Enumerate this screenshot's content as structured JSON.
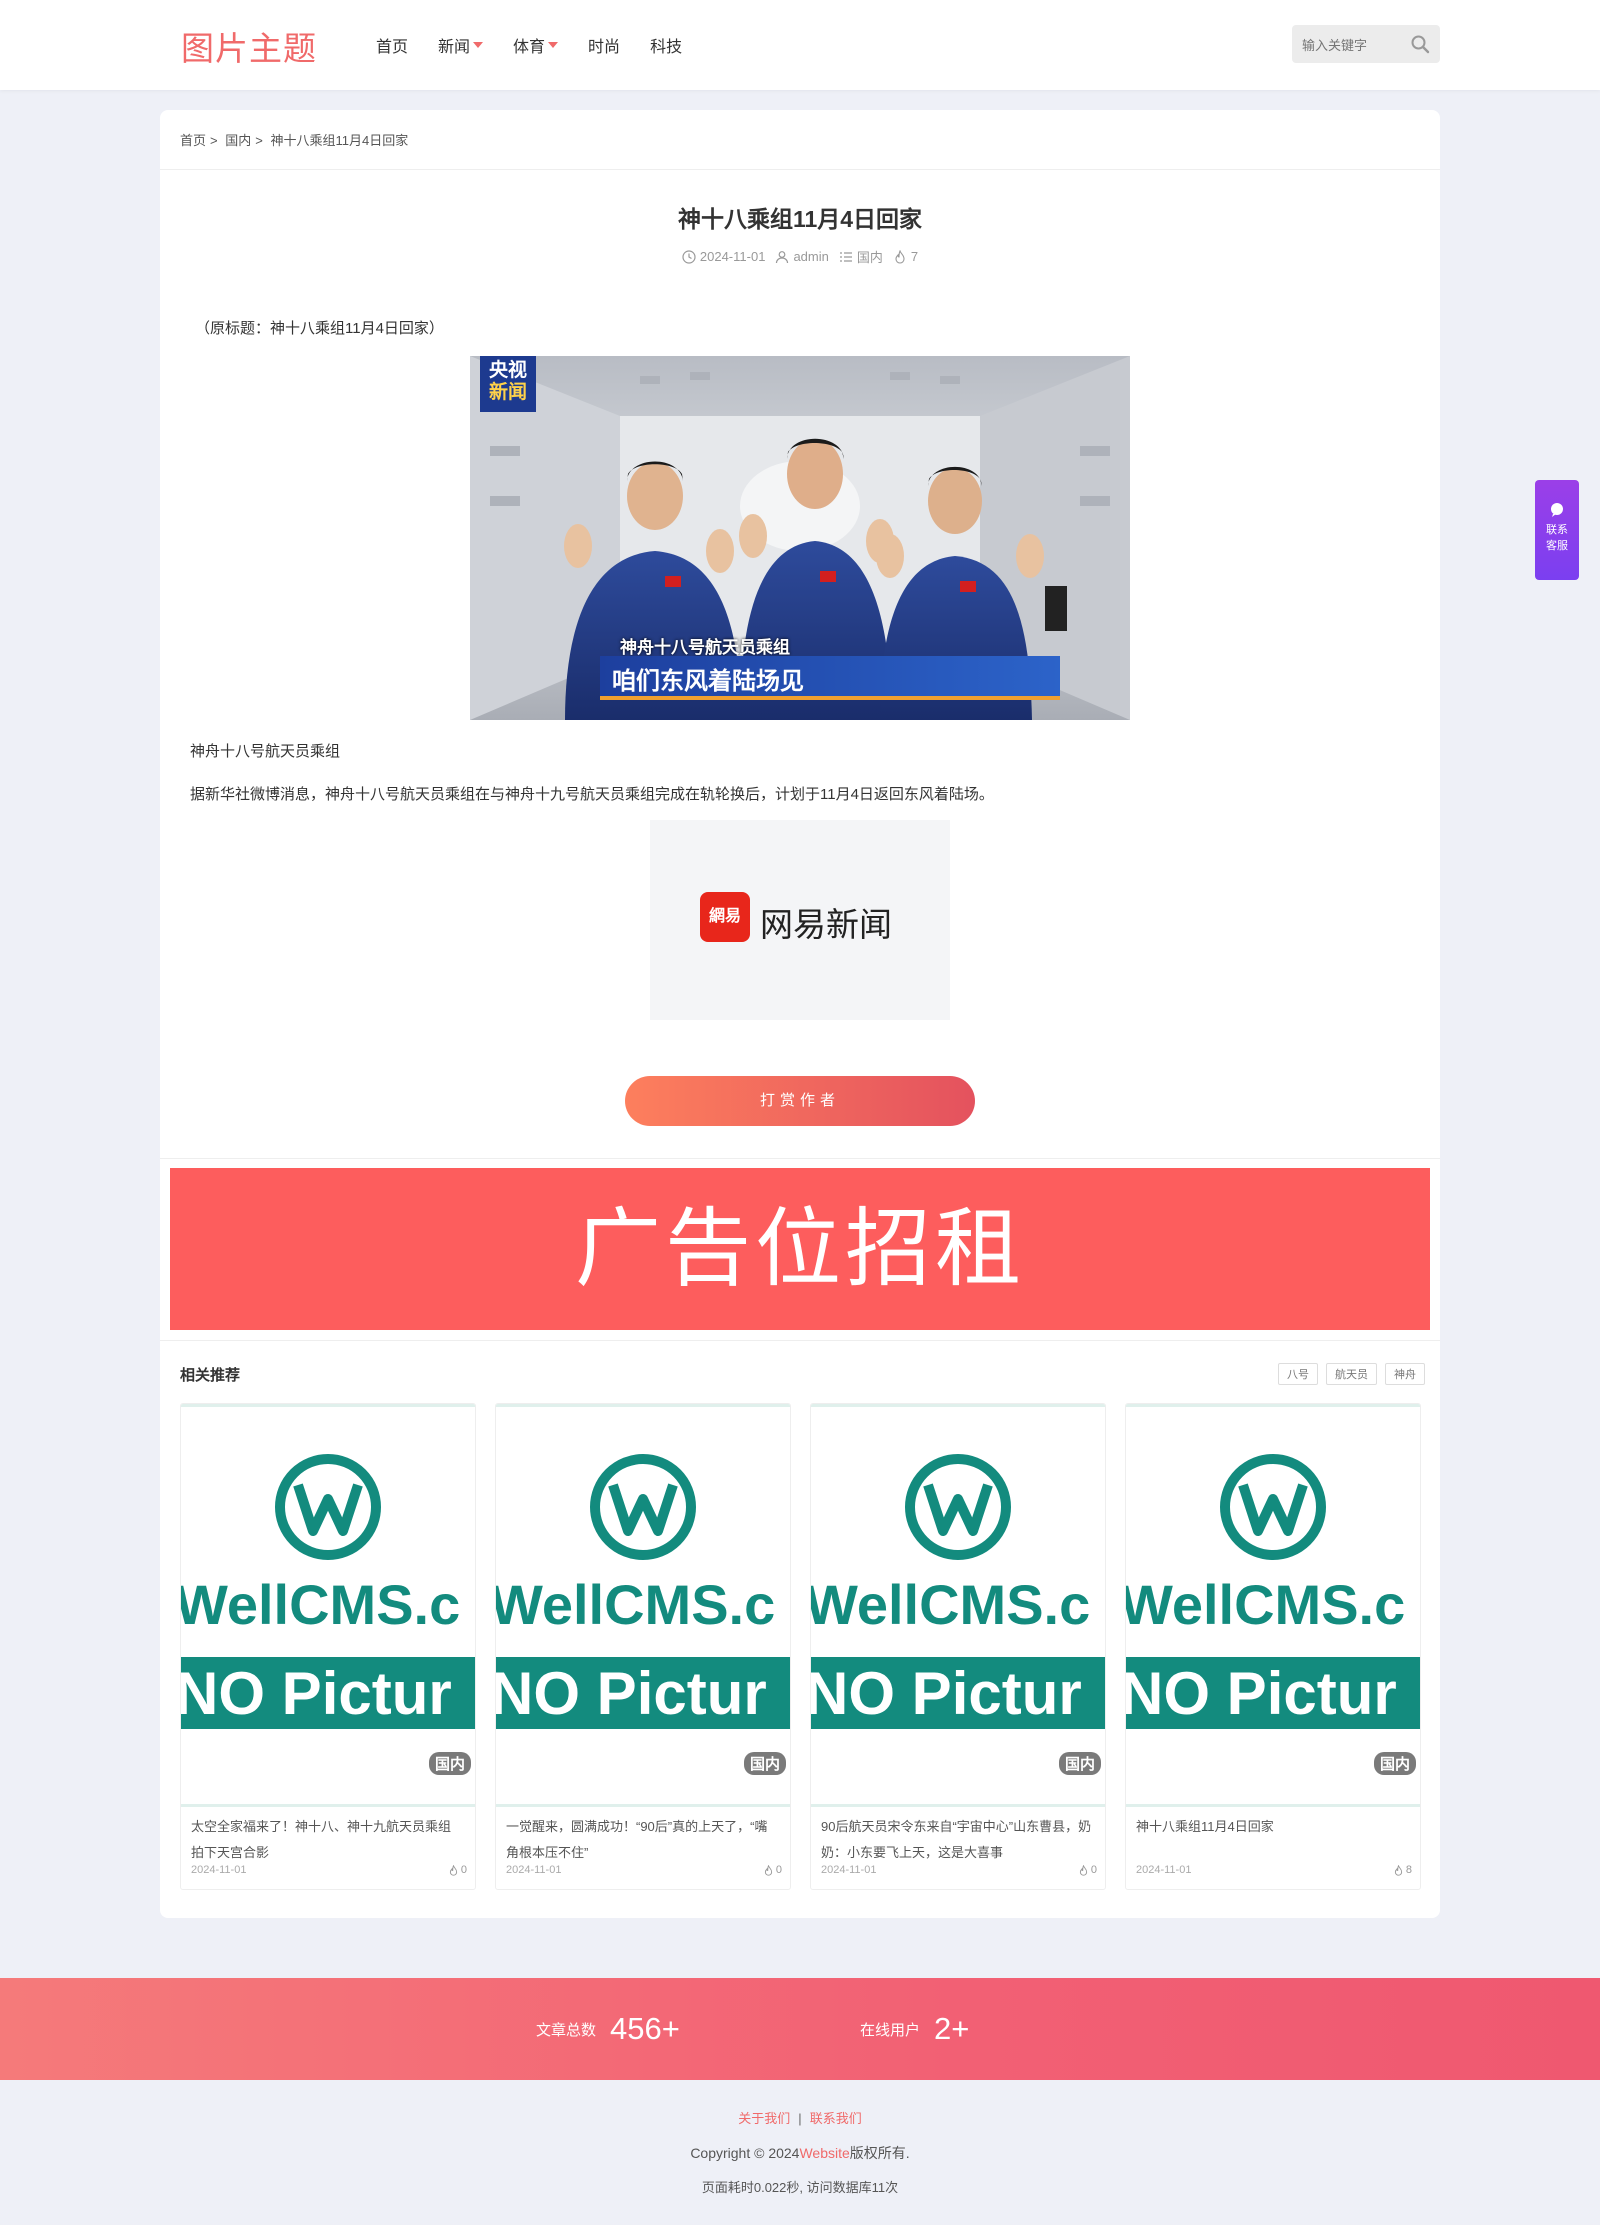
{
  "header": {
    "logo": "图片主题",
    "nav": [
      {
        "label": "首页",
        "dropdown": false
      },
      {
        "label": "新闻",
        "dropdown": true
      },
      {
        "label": "体育",
        "dropdown": true
      },
      {
        "label": "时尚",
        "dropdown": false
      },
      {
        "label": "科技",
        "dropdown": false
      }
    ],
    "search_placeholder": "输入关键字"
  },
  "breadcrumb": [
    "首页",
    "国内",
    "神十八乘组11月4日回家"
  ],
  "article": {
    "title": "神十八乘组11月4日回家",
    "date": "2024-11-01",
    "author": "admin",
    "category": "国内",
    "hits": "7",
    "orig_title": "（原标题：神十八乘组11月4日回家）",
    "photo": {
      "tv_logo_top": "央视",
      "tv_logo_bottom": "新闻",
      "caption_small": "神舟十八号航天员乘组",
      "caption_big": "咱们东风着陆场见"
    },
    "photo_caption": "神舟十八号航天员乘组",
    "body": "据新华社微博消息，神舟十八号航天员乘组在与神舟十九号航天员乘组完成在轨轮换后，计划于11月4日返回东风着陆场。",
    "source_logo_icon": "網易",
    "source_logo_text": "网易新闻",
    "reward_label": "打赏作者"
  },
  "ad": {
    "text": "广告位招租"
  },
  "related": {
    "title": "相关推荐",
    "tags": [
      "八号",
      "航天员",
      "神舟"
    ],
    "placeholder": {
      "line1": "WellCMS.c",
      "line2": "NO Pictur"
    },
    "items": [
      {
        "title": "太空全家福来了！神十八、神十九航天员乘组拍下天宫合影",
        "date": "2024-11-01",
        "hits": "0",
        "category": "国内"
      },
      {
        "title": "一觉醒来，圆满成功！“90后”真的上天了，“嘴角根本压不住”",
        "date": "2024-11-01",
        "hits": "0",
        "category": "国内"
      },
      {
        "title": "90后航天员宋令东来自“宇宙中心”山东曹县，奶奶：小东要飞上天，这是大喜事",
        "date": "2024-11-01",
        "hits": "0",
        "category": "国内"
      },
      {
        "title": "神十八乘组11月4日回家",
        "date": "2024-11-01",
        "hits": "8",
        "category": "国内"
      }
    ]
  },
  "side_contact": {
    "line1": "联系",
    "line2": "客服"
  },
  "stats": [
    {
      "label": "文章总数",
      "value": "456+"
    },
    {
      "label": "在线用户",
      "value": "2+"
    }
  ],
  "footer": {
    "links": [
      "关于我们",
      "联系我们"
    ],
    "copyright_prefix": "Copyright © 2024",
    "copyright_site": "Website",
    "copyright_suffix": "版权所有.",
    "timing": "页面耗时0.022秒, 访问数据库11次"
  },
  "colors": {
    "accent": "#f06a6a",
    "ad_bg": "#fd5d5d",
    "placeholder_teal": "#138b7e"
  }
}
